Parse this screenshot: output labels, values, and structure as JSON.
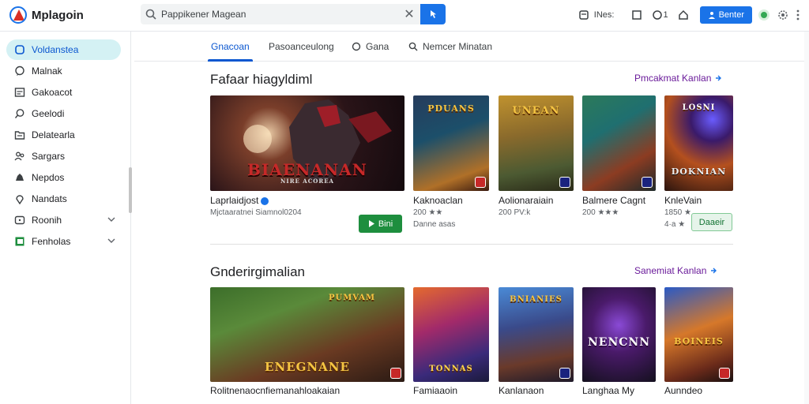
{
  "app": {
    "title": "Mplagoin"
  },
  "search": {
    "value": "Pappikener Magean"
  },
  "header": {
    "items_label": "INes:",
    "count_label": "1",
    "signin_label": "Benter"
  },
  "sidebar": {
    "items": [
      {
        "label": "Voldanstea",
        "icon": "home-icon",
        "active": true
      },
      {
        "label": "Malnak",
        "icon": "chat-icon"
      },
      {
        "label": "Gakoacot",
        "icon": "calendar-icon"
      },
      {
        "label": "Geelodi",
        "icon": "search-icon"
      },
      {
        "label": "Delatearla",
        "icon": "folder-icon"
      },
      {
        "label": "Sargars",
        "icon": "people-icon"
      },
      {
        "label": "Nepdos",
        "icon": "cloud-icon"
      },
      {
        "label": "Nandats",
        "icon": "pin-icon"
      },
      {
        "label": "Roonih",
        "icon": "box-icon",
        "expandable": true
      },
      {
        "label": "Fenholas",
        "icon": "green-book-icon",
        "expandable": true
      }
    ]
  },
  "tabs": [
    {
      "label": "Gnacoan",
      "active": true
    },
    {
      "label": "Pasoanceulong"
    },
    {
      "label": "Gana"
    },
    {
      "label": "Nemcer Minatan"
    }
  ],
  "sections": [
    {
      "title": "Fafaar hiagyldiml",
      "see_more": "Pmcakmat Kanlan",
      "cards": [
        {
          "name": "Laprlaidjost",
          "meta": "Mjctaaratnei Siamnol0204",
          "art_text": "BIAENANAN",
          "art_sub": "NIRE ACOREA",
          "button": "Bini",
          "verified": true
        },
        {
          "name": "Kaknoaclan",
          "meta": "200 ★★",
          "meta2": "Danne asas",
          "art_text": "PDUANS",
          "art_sub": ""
        },
        {
          "name": "Aolionaraiain",
          "meta": "200 PV:k",
          "art_text": "UNEAN",
          "art_sub": ""
        },
        {
          "name": "Balmere Cagnt",
          "meta": "200 ★★★",
          "art_text": "",
          "art_sub": ""
        },
        {
          "name": "KnleVain",
          "meta": "1850 ★",
          "meta2": "4·a ★",
          "art_text": "DOKNIAN",
          "art_sub": "LOSNI",
          "button": "Daaeir"
        }
      ]
    },
    {
      "title": "Gnderirgimalian",
      "see_more": "Sanemiat Kanlan",
      "cards": [
        {
          "name": "Rolitnenaocnfiemanahloakaian",
          "meta": "",
          "art_text": "ENEGNANE",
          "art_sub": "PUMVAM"
        },
        {
          "name": "Famiaaoin",
          "meta": "",
          "art_text": "TONNAS",
          "art_sub": ""
        },
        {
          "name": "Kanlanaon",
          "meta": "",
          "art_text": "BNIANIES",
          "art_sub": ""
        },
        {
          "name": "Langhaa My",
          "meta": "",
          "art_text": "NENCNN",
          "art_sub": ""
        },
        {
          "name": "Aunndeo",
          "meta": "",
          "art_text": "BOINEIS",
          "art_sub": ""
        }
      ]
    }
  ],
  "colors": {
    "accent": "#1a73e8",
    "active_tab": "#0b57d0",
    "see_more": "#6a1b9a",
    "cta_green": "#1e8e3e",
    "sidebar_active": "#d4f1f4"
  }
}
